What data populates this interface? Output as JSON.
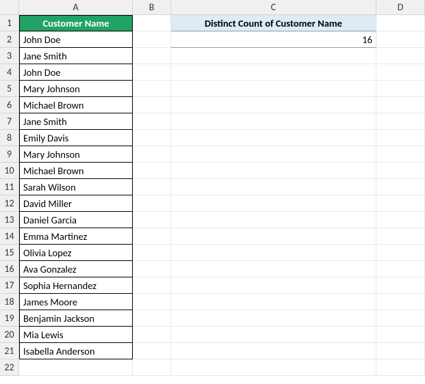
{
  "columns": {
    "A": "A",
    "B": "B",
    "C": "C",
    "D": "D"
  },
  "rowNumbers": [
    "1",
    "2",
    "3",
    "4",
    "5",
    "6",
    "7",
    "8",
    "9",
    "10",
    "11",
    "12",
    "13",
    "14",
    "15",
    "16",
    "17",
    "18",
    "19",
    "20",
    "21",
    "22"
  ],
  "headerA": "Customer Name",
  "headerC": "Distinct Count of Customer Name",
  "distinctCount": "16",
  "customers": [
    "John Doe",
    "Jane Smith",
    "John Doe",
    "Mary Johnson",
    "Michael Brown",
    "Jane Smith",
    "Emily Davis",
    "Mary Johnson",
    "Michael Brown",
    "Sarah Wilson",
    "David Miller",
    "Daniel Garcia",
    "Emma Martinez",
    "Olivia Lopez",
    "Ava Gonzalez",
    "Sophia Hernandez",
    "James Moore",
    "Benjamin Jackson",
    "Mia Lewis",
    "Isabella Anderson"
  ]
}
